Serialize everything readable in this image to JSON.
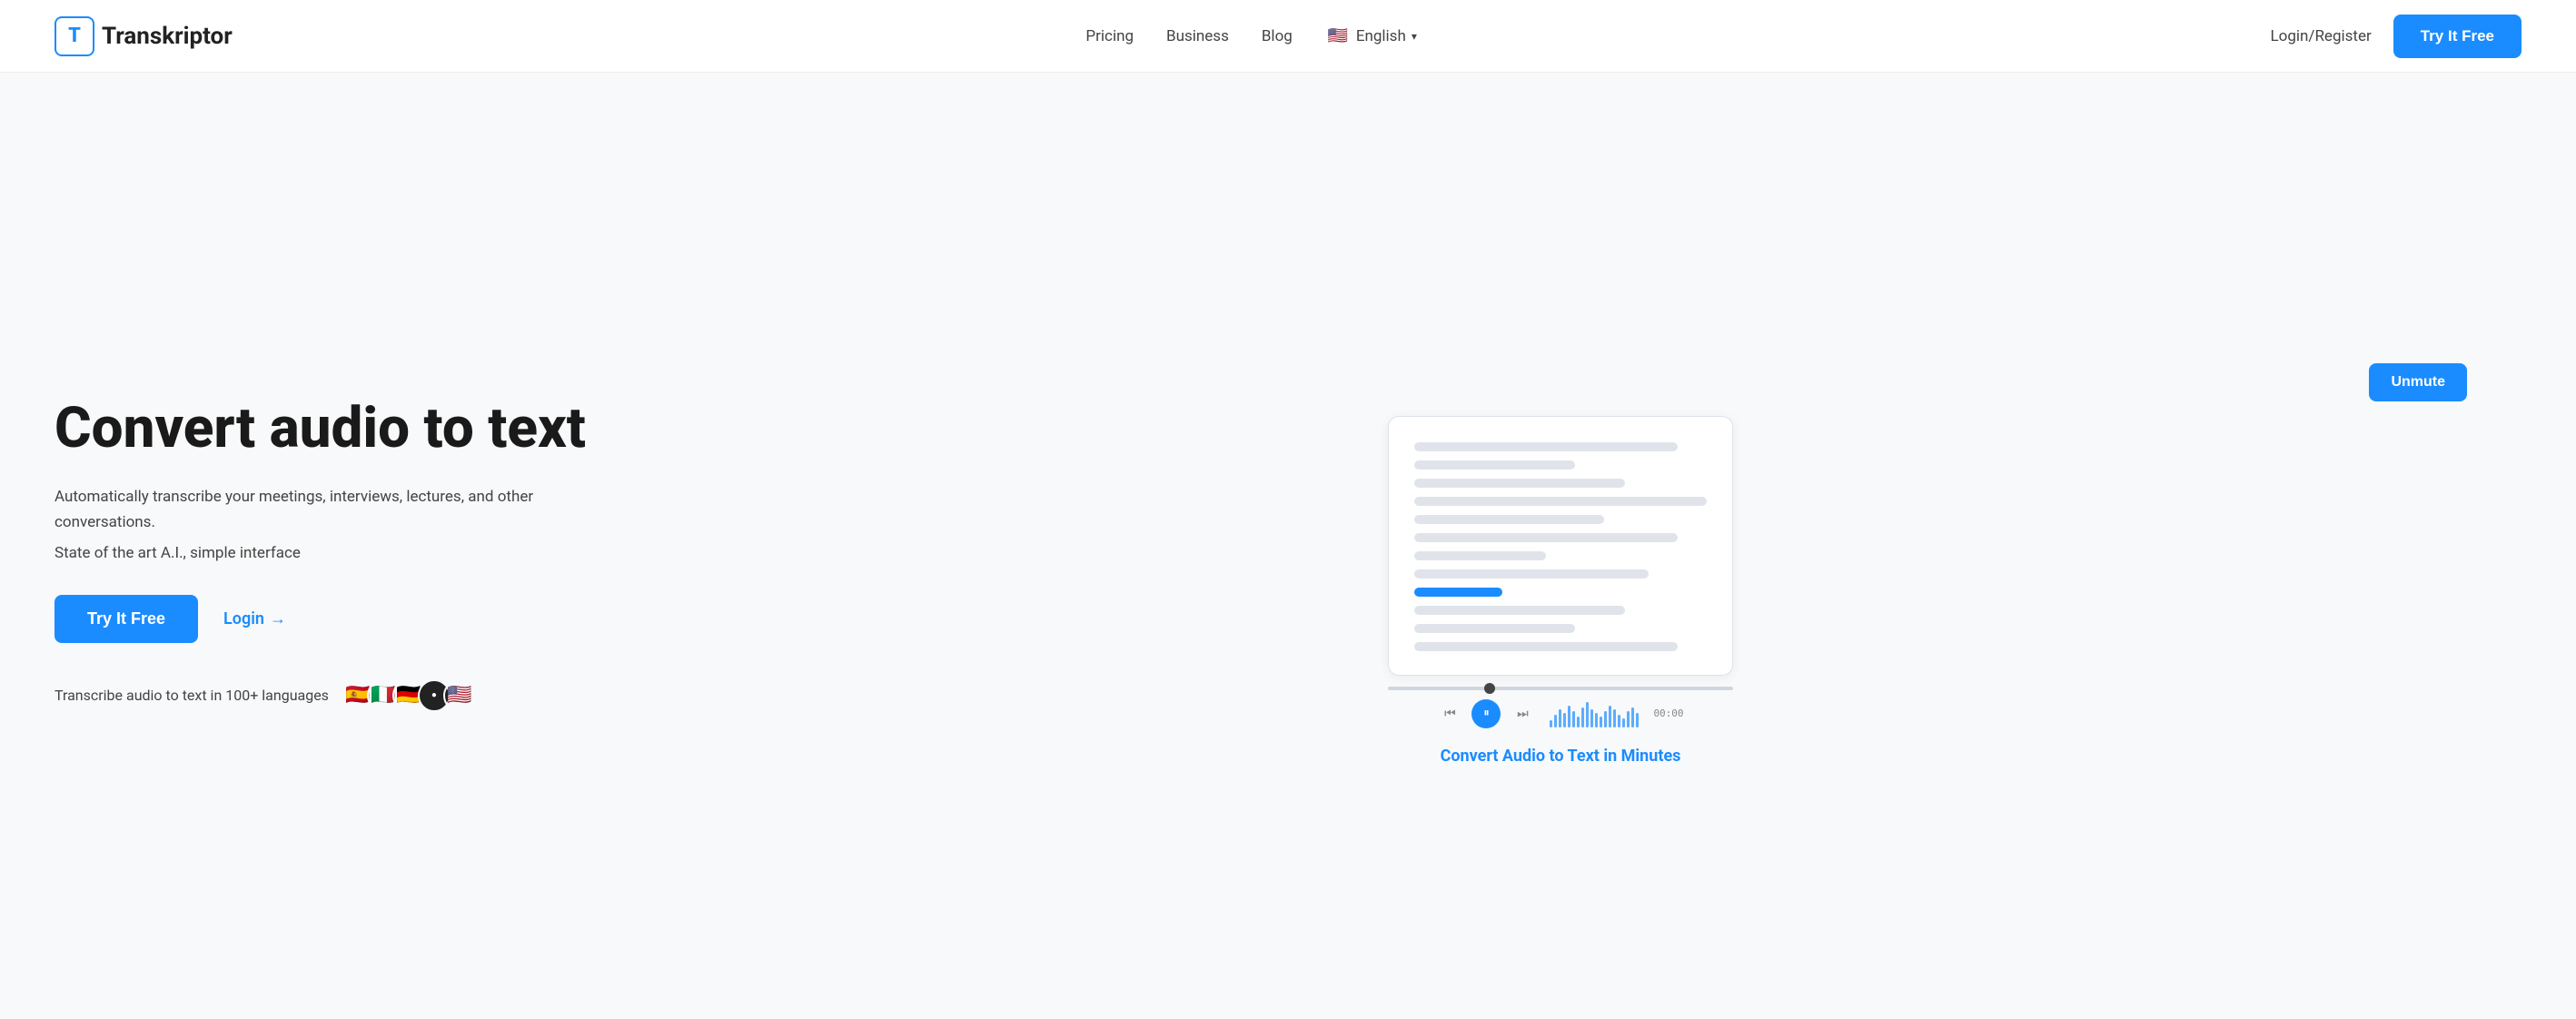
{
  "nav": {
    "logo_letter": "T",
    "logo_name_start": "",
    "logo_name": "Transkriptor",
    "links": [
      {
        "label": "Pricing",
        "id": "pricing"
      },
      {
        "label": "Business",
        "id": "business"
      },
      {
        "label": "Blog",
        "id": "blog"
      }
    ],
    "language": {
      "label": "English",
      "flag": "🇺🇸"
    },
    "login_label": "Login/Register",
    "cta_label": "Try It Free"
  },
  "hero": {
    "title": "Convert audio to text",
    "subtitle": "Automatically transcribe your meetings, interviews, lectures, and other conversations.",
    "feature": "State of the art A.I., simple interface",
    "cta_primary": "Try It Free",
    "cta_secondary": "Login",
    "cta_secondary_arrow": "→",
    "languages_label": "Transcribe audio to text in 100+ languages",
    "language_flags": [
      "🇪🇸",
      "🇮🇹",
      "🇩🇪",
      "⚫",
      "🇺🇸"
    ]
  },
  "player": {
    "unmute_label": "Unmute",
    "time": "00:00",
    "convert_label": "Convert Audio to Text in Minutes"
  },
  "transcript_lines": [
    {
      "width": "90",
      "type": "long"
    },
    {
      "width": "55",
      "type": "short"
    },
    {
      "width": "72",
      "type": "medium"
    },
    {
      "width": "100",
      "type": "xlong"
    },
    {
      "width": "65",
      "type": "medium"
    },
    {
      "width": "90",
      "type": "long"
    },
    {
      "width": "45",
      "type": "xshort"
    },
    {
      "width": "80",
      "type": "medium"
    },
    {
      "width": "30",
      "type": "blue"
    },
    {
      "width": "72",
      "type": "medium"
    },
    {
      "width": "55",
      "type": "short"
    },
    {
      "width": "90",
      "type": "long"
    }
  ],
  "wave_heights": [
    8,
    14,
    20,
    16,
    24,
    18,
    12,
    22,
    28,
    20,
    16,
    12,
    18,
    24,
    20,
    14,
    10,
    18,
    22,
    16
  ]
}
